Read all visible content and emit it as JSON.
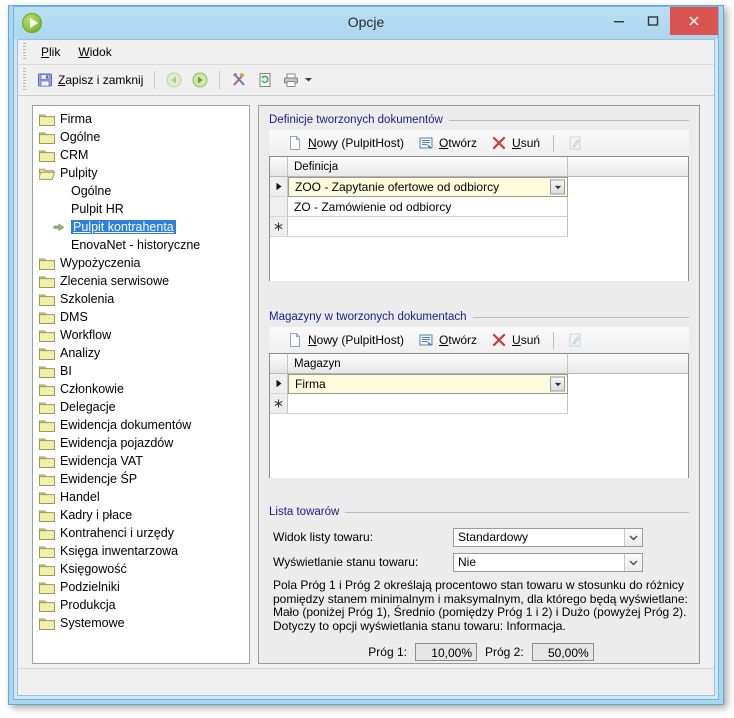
{
  "window": {
    "title": "Opcje",
    "app_icon": "play-circle-icon",
    "minimize_label": "−",
    "maximize_label": "□",
    "close_label": "✕",
    "close_color": "#d9534f",
    "title_bar_color": "#b5dcf2",
    "frame_color": "#a8d8f0"
  },
  "menu": {
    "items": [
      {
        "label": "Plik",
        "accel": "P",
        "rest": "lik"
      },
      {
        "label": "Widok",
        "accel": "W",
        "rest": "idok"
      }
    ]
  },
  "toolbar": {
    "save_label": "Zapisz i zamknij",
    "save_icon": "floppy-disk-icon",
    "back_icon": "arrow-left-circle-icon",
    "forward_icon": "arrow-right-circle-icon",
    "tools_icon": "hammer-wrench-icon",
    "refresh_doc_icon": "page-refresh-icon",
    "print_icon": "printer-icon",
    "print_dropdown_icon": "chevron-down-icon"
  },
  "tree": {
    "nodes": [
      {
        "label": "Firma",
        "level": 0,
        "icon": "folder-icon",
        "selected": false
      },
      {
        "label": "Ogólne",
        "level": 0,
        "icon": "folder-icon",
        "selected": false
      },
      {
        "label": "CRM",
        "level": 0,
        "icon": "folder-icon",
        "selected": false
      },
      {
        "label": "Pulpity",
        "level": 0,
        "icon": "folder-open-icon",
        "selected": false
      },
      {
        "label": "Ogólne",
        "level": 1,
        "icon": "none",
        "selected": false
      },
      {
        "label": "Pulpit HR",
        "level": 1,
        "icon": "none",
        "selected": false
      },
      {
        "label": "Pulpit kontrahenta",
        "level": 1,
        "icon": "none",
        "selected": true
      },
      {
        "label": "EnovaNet - historyczne",
        "level": 1,
        "icon": "none",
        "selected": false
      },
      {
        "label": "Wypożyczenia",
        "level": 0,
        "icon": "folder-icon",
        "selected": false
      },
      {
        "label": "Zlecenia serwisowe",
        "level": 0,
        "icon": "folder-icon",
        "selected": false
      },
      {
        "label": "Szkolenia",
        "level": 0,
        "icon": "folder-icon",
        "selected": false
      },
      {
        "label": "DMS",
        "level": 0,
        "icon": "folder-icon",
        "selected": false
      },
      {
        "label": "Workflow",
        "level": 0,
        "icon": "folder-icon",
        "selected": false
      },
      {
        "label": "Analizy",
        "level": 0,
        "icon": "folder-icon",
        "selected": false
      },
      {
        "label": "BI",
        "level": 0,
        "icon": "folder-icon",
        "selected": false
      },
      {
        "label": "Członkowie",
        "level": 0,
        "icon": "folder-icon",
        "selected": false
      },
      {
        "label": "Delegacje",
        "level": 0,
        "icon": "folder-icon",
        "selected": false
      },
      {
        "label": "Ewidencja dokumentów",
        "level": 0,
        "icon": "folder-icon",
        "selected": false
      },
      {
        "label": "Ewidencja pojazdów",
        "level": 0,
        "icon": "folder-icon",
        "selected": false
      },
      {
        "label": "Ewidencja VAT",
        "level": 0,
        "icon": "folder-icon",
        "selected": false
      },
      {
        "label": "Ewidencje ŚP",
        "level": 0,
        "icon": "folder-icon",
        "selected": false
      },
      {
        "label": "Handel",
        "level": 0,
        "icon": "folder-icon",
        "selected": false
      },
      {
        "label": "Kadry i płace",
        "level": 0,
        "icon": "folder-icon",
        "selected": false
      },
      {
        "label": "Kontrahenci i urzędy",
        "level": 0,
        "icon": "folder-icon",
        "selected": false
      },
      {
        "label": "Księga inwentarzowa",
        "level": 0,
        "icon": "folder-icon",
        "selected": false
      },
      {
        "label": "Księgowość",
        "level": 0,
        "icon": "folder-icon",
        "selected": false
      },
      {
        "label": "Podzielniki",
        "level": 0,
        "icon": "folder-icon",
        "selected": false
      },
      {
        "label": "Produkcja",
        "level": 0,
        "icon": "folder-icon",
        "selected": false
      },
      {
        "label": "Systemowe",
        "level": 0,
        "icon": "folder-icon",
        "selected": false
      }
    ],
    "selection_color": "#2f7fe0"
  },
  "definitions_group": {
    "title": "Definicje tworzonych dokumentów",
    "toolbar": {
      "new_label": "Nowy (PulpitHost)",
      "open_label": "Otwórz",
      "delete_label": "Usuń",
      "new_icon": "new-page-icon",
      "open_icon": "open-document-icon",
      "delete_icon": "red-x-icon",
      "edit_icon": "edit-pencil-icon",
      "edit_disabled": true
    },
    "column_header": "Definicja",
    "rows": [
      {
        "value": "ZOO - Zapytanie ofertowe od odbiorcy",
        "current": true,
        "new_row": false
      },
      {
        "value": "ZO - Zamówienie od odbiorcy",
        "current": false,
        "new_row": false
      },
      {
        "value": "",
        "current": false,
        "new_row": true
      }
    ]
  },
  "warehouses_group": {
    "title": "Magazyny w tworzonych dokumentach",
    "toolbar": {
      "new_label": "Nowy (PulpitHost)",
      "open_label": "Otwórz",
      "delete_label": "Usuń",
      "new_icon": "new-page-icon",
      "open_icon": "open-document-icon",
      "delete_icon": "red-x-icon",
      "edit_icon": "edit-pencil-icon",
      "edit_disabled": true
    },
    "column_header": "Magazyn",
    "rows": [
      {
        "value": "Firma",
        "current": true,
        "new_row": false
      },
      {
        "value": "",
        "current": false,
        "new_row": true
      }
    ]
  },
  "goods_group": {
    "title": "Lista towarów",
    "fields": [
      {
        "label": "Widok listy towaru:",
        "value": "Standardowy"
      },
      {
        "label": "Wyświetlanie stanu towaru:",
        "value": "Nie"
      }
    ],
    "description": "Pola Próg 1 i Próg 2 określają procentowo stan towaru w stosunku do różnicy\npomiędzy stanem minimalnym i maksymalnym, dla którego będą wyświetlane:\nMało (poniżej Próg 1), Średnio (pomiędzy Próg 1 i 2) i Dużo (powyżej Próg 2).\nDotyczy to opcji wyświetlania stanu towaru: Informacja.",
    "prog1_label": "Próg 1:",
    "prog1_value": "10,00%",
    "prog2_label": "Próg 2:",
    "prog2_value": "50,00%"
  }
}
